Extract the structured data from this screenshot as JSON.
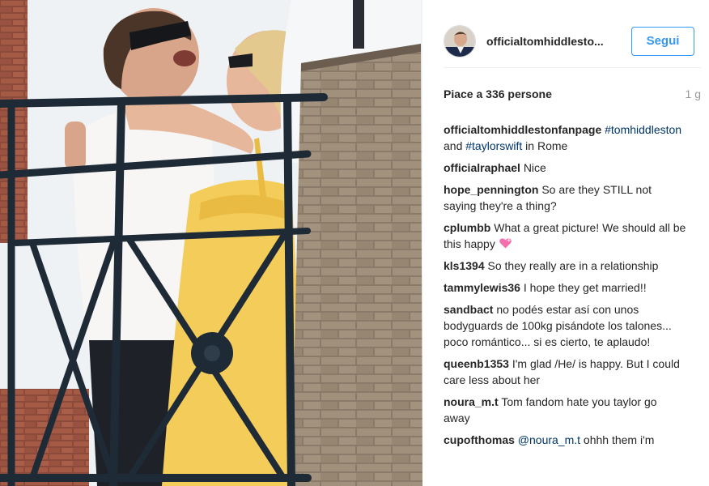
{
  "post": {
    "username": "officialtomhiddlesto...",
    "follow_label": "Segui",
    "likes_text": "Piace a 336 persone",
    "age": "1 g"
  },
  "comments": [
    {
      "author": "officialtomhiddlestonfanpage",
      "parts": [
        {
          "type": "hashtag",
          "text": "#tomhiddleston"
        },
        {
          "type": "text",
          "text": " and "
        },
        {
          "type": "hashtag",
          "text": "#taylorswift"
        },
        {
          "type": "text",
          "text": " in Rome"
        }
      ]
    },
    {
      "author": "officialraphael",
      "parts": [
        {
          "type": "text",
          "text": "Nice"
        }
      ]
    },
    {
      "author": "hope_pennington",
      "parts": [
        {
          "type": "text",
          "text": "So are they STILL not saying they're a thing?"
        }
      ]
    },
    {
      "author": "cplumbb",
      "parts": [
        {
          "type": "text",
          "text": "What a great picture! We should all be this happy "
        },
        {
          "type": "emoji",
          "text": "heart-emoji"
        }
      ]
    },
    {
      "author": "kls1394",
      "parts": [
        {
          "type": "text",
          "text": "So they really are in a relationship"
        }
      ]
    },
    {
      "author": "tammylewis36",
      "parts": [
        {
          "type": "text",
          "text": "I hope they get married!!"
        }
      ]
    },
    {
      "author": "sandbact",
      "parts": [
        {
          "type": "text",
          "text": "no podés estar así con unos bodyguards de 100kg pisándote los talones... poco romántico... si es cierto, te aplaudo!"
        }
      ]
    },
    {
      "author": "queenb1353",
      "parts": [
        {
          "type": "text",
          "text": "I'm glad /He/ is happy. But I could care less about her"
        }
      ]
    },
    {
      "author": "noura_m.t",
      "parts": [
        {
          "type": "text",
          "text": "Tom fandom hate you taylor go away"
        }
      ]
    },
    {
      "author": "cupofthomas",
      "parts": [
        {
          "type": "mention",
          "text": "@noura_m.t"
        },
        {
          "type": "text",
          "text": " ohhh them i'm"
        }
      ]
    }
  ],
  "colors": {
    "accent": "#3897f0",
    "link": "#003569",
    "text": "#262626",
    "muted": "#999999"
  }
}
